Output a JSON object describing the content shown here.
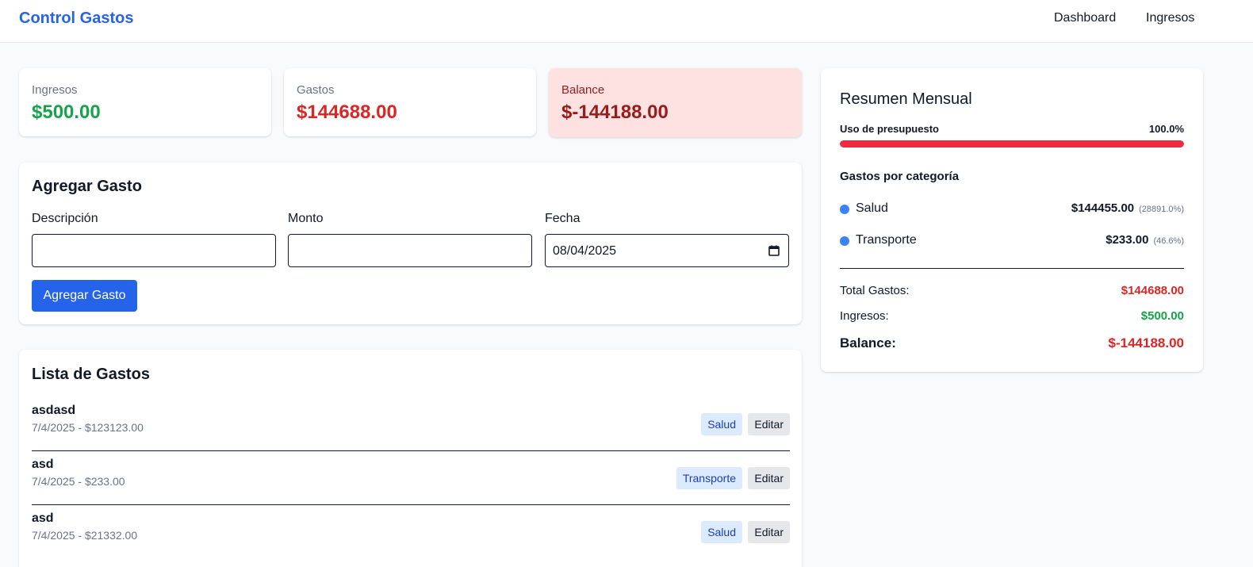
{
  "app": {
    "title": "Control Gastos"
  },
  "nav": {
    "dashboard": "Dashboard",
    "ingresos": "Ingresos"
  },
  "stats": {
    "ingresos": {
      "label": "Ingresos",
      "value": "$500.00",
      "color": "#16a34a"
    },
    "gastos": {
      "label": "Gastos",
      "value": "$144688.00",
      "color": "#dc2626"
    },
    "balance": {
      "label": "Balance",
      "value": "$-144188.00",
      "color": "#991b1b",
      "background": "#fee2e2"
    }
  },
  "add_form": {
    "title": "Agregar Gasto",
    "descripcion_label": "Descripción",
    "descripcion_value": "",
    "monto_label": "Monto",
    "monto_value": "",
    "fecha_label": "Fecha",
    "fecha_value": "08/04/2025",
    "submit_label": "Agregar Gasto",
    "calendar_icon": "calendar-icon"
  },
  "expense_list": {
    "title": "Lista de Gastos",
    "edit_label": "Editar",
    "items": [
      {
        "description": "asdasd",
        "meta": "7/4/2025 - $123123.00",
        "category": "Salud"
      },
      {
        "description": "asd",
        "meta": "7/4/2025 - $233.00",
        "category": "Transporte"
      },
      {
        "description": "asd",
        "meta": "7/4/2025 - $21332.00",
        "category": "Salud"
      }
    ]
  },
  "summary": {
    "title": "Resumen Mensual",
    "budget_label": "Uso de presupuesto",
    "budget_pct_text": "100.0%",
    "budget_fraction": 1.0,
    "categories_heading": "Gastos por categoría",
    "categories": [
      {
        "name": "Salud",
        "amount": "$144455.00",
        "pct": "(28891.0%)"
      },
      {
        "name": "Transporte",
        "amount": "$233.00",
        "pct": "(46.6%)"
      }
    ],
    "total_gastos_label": "Total Gastos:",
    "total_gastos_value": "$144688.00",
    "ingresos_label": "Ingresos:",
    "ingresos_value": "$500.00",
    "balance_label": "Balance:",
    "balance_value": "$-144188.00"
  },
  "colors": {
    "accent": "#2563eb",
    "positive": "#16a34a",
    "negative": "#dc2626",
    "badge_bg": "#dbeafe",
    "badge_text": "#1e40af",
    "category_dot": "#3b82f6",
    "progress": "#ef2b3d"
  }
}
